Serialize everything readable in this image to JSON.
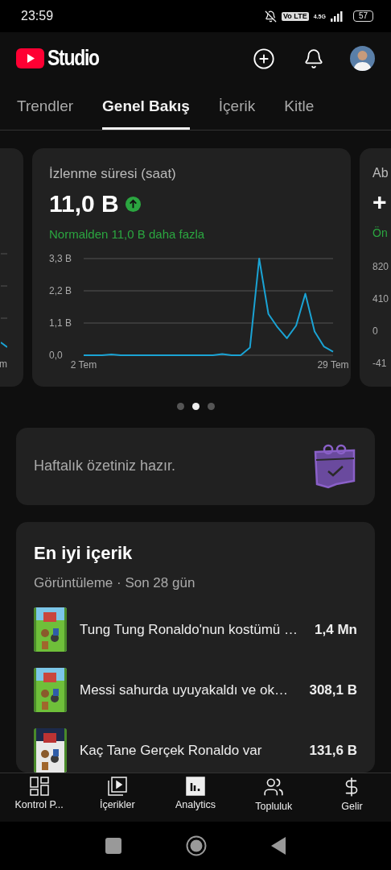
{
  "status_bar": {
    "time": "23:59",
    "volte": "Vo LTE",
    "network": "4.5G",
    "battery": "57"
  },
  "header": {
    "title": "Studio"
  },
  "tabs": [
    {
      "label": "Trendler",
      "selected": false
    },
    {
      "label": "Genel Bakış",
      "selected": true
    },
    {
      "label": "İçerik",
      "selected": false
    },
    {
      "label": "Kitle",
      "selected": false
    }
  ],
  "cards": [
    {
      "kind": "fragment_left",
      "x_label": "m"
    },
    {
      "kind": "metric",
      "title": "İzlenme süresi (saat)",
      "value": "11,0 B",
      "increase": true,
      "comparison": "Normalden 11,0 B daha fazla",
      "chart_data": {
        "type": "line",
        "x": [
          2,
          3,
          4,
          5,
          6,
          7,
          8,
          9,
          10,
          11,
          12,
          13,
          14,
          15,
          16,
          17,
          18,
          19,
          20,
          21,
          22,
          23,
          24,
          25,
          26,
          27,
          28,
          29
        ],
        "series": [
          {
            "color": "#1aa3d4",
            "values": [
              0,
              0,
              0,
              0.03,
              0,
              0,
              0,
              0,
              0,
              0,
              0,
              0,
              0,
              0,
              0,
              0.04,
              0,
              0,
              0.26,
              3.3,
              1.41,
              0.95,
              0.58,
              1.01,
              2.1,
              0.81,
              0.3,
              0.12
            ]
          }
        ],
        "xlim": [
          2,
          29
        ],
        "ylim": [
          0,
          3.3
        ],
        "yticks": [
          {
            "value": 0,
            "label": "0,0"
          },
          {
            "value": 1.1,
            "label": "1,1 B"
          },
          {
            "value": 2.2,
            "label": "2,2 B"
          },
          {
            "value": 3.3,
            "label": "3,3 B"
          }
        ],
        "xticks": [
          {
            "value": 2,
            "label": "2 Tem"
          },
          {
            "value": 29,
            "label": "29 Tem"
          }
        ]
      }
    },
    {
      "kind": "fragment_right",
      "title": "Ab",
      "value": "+",
      "comparison": "Ön",
      "y_labels": [
        "820",
        "410",
        "0",
        "-41"
      ]
    }
  ],
  "carousel_dots": [
    {
      "selected": false
    },
    {
      "selected": true
    },
    {
      "selected": false
    }
  ],
  "weekly_summary": {
    "text": "Haftalık özetiniz hazır."
  },
  "top_content": {
    "title": "En iyi içerik",
    "subtitle": "Görüntüleme · Son 28 gün",
    "items": [
      {
        "title": "Tung Tung Ronaldo'nun kostümü …",
        "views": "1,4 Mn"
      },
      {
        "title": "Messi sahurda uyuyakaldı ve ok…",
        "views": "308,1 B"
      },
      {
        "title": "Kaç Tane Gerçek Ronaldo var",
        "views": "131,6 B"
      }
    ]
  },
  "bottom_nav": [
    {
      "label": "Kontrol P...",
      "kind": "dashboard",
      "selected": false
    },
    {
      "label": "İçerikler",
      "kind": "content",
      "selected": false
    },
    {
      "label": "Analytics",
      "kind": "analytics",
      "selected": true
    },
    {
      "label": "Topluluk",
      "kind": "community",
      "selected": false
    },
    {
      "label": "Gelir",
      "kind": "revenue",
      "selected": false
    }
  ]
}
